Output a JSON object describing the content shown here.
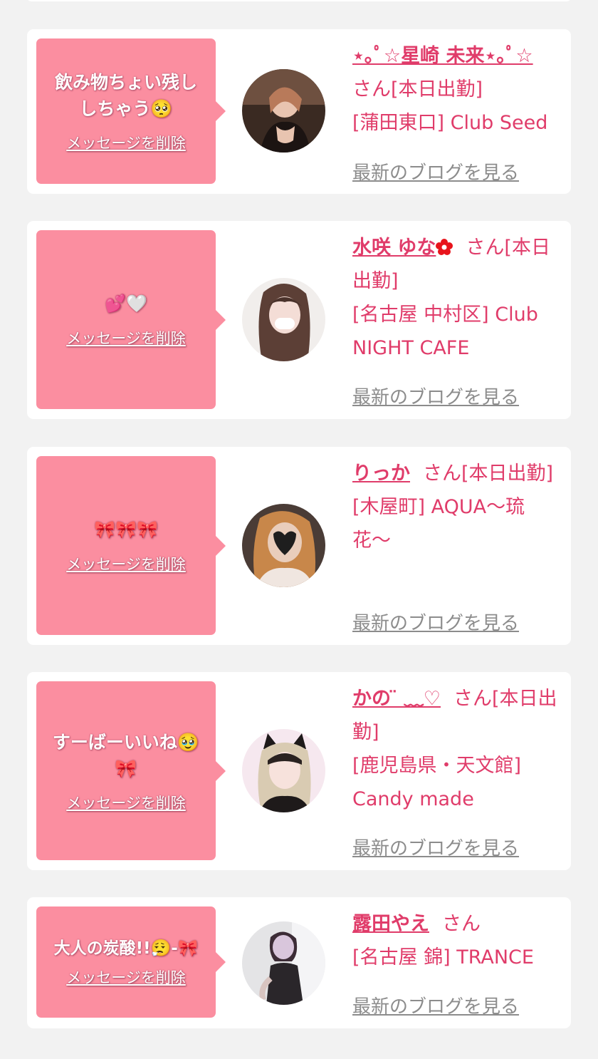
{
  "cards": [
    {
      "message": "飲み物ちょい残ししちゃう🥺",
      "delete_label": "メッセージを削除",
      "name": "⋆｡ﾟ☆星崎 未来⋆｡ﾟ☆",
      "suffix": "さん[本日出勤]",
      "store": "[蒲田東口] Club Seed",
      "blog_label": "最新のブログを見る"
    },
    {
      "message": "💕🤍",
      "delete_label": "メッセージを削除",
      "name": "水咲 ゆな",
      "name_icon": "red-flower-icon",
      "suffix": "さん[本日出勤]",
      "store": "[名古屋 中村区] Club NIGHT CAFE",
      "blog_label": "最新のブログを見る"
    },
    {
      "message": "🎀🎀🎀",
      "delete_label": "メッセージを削除",
      "name": "りっか",
      "suffix": "さん[本日出勤]",
      "store": "[木屋町] AQUA〜琉花〜",
      "blog_label": "最新のブログを見る"
    },
    {
      "message": "すーばーいいね🥹🎀",
      "delete_label": "メッセージを削除",
      "name": "かの ̈ ︎﹏♡",
      "suffix": "さん[本日出勤]",
      "store": "[鹿児島県・天文館] Candy made",
      "blog_label": "最新のブログを見る"
    },
    {
      "message": "大人の炭酸!!😮‍💨-🎀",
      "delete_label": "メッセージを削除",
      "name": "露田やえ",
      "suffix": "さん",
      "store": "[名古屋 錦] TRANCE",
      "blog_label": "最新のブログを見る"
    }
  ],
  "colors": {
    "background": "#f2f2f2",
    "card": "#ffffff",
    "bubble": "#fb8ea0",
    "accent_text": "#e03c6a",
    "muted_link": "#8c8c8c"
  }
}
